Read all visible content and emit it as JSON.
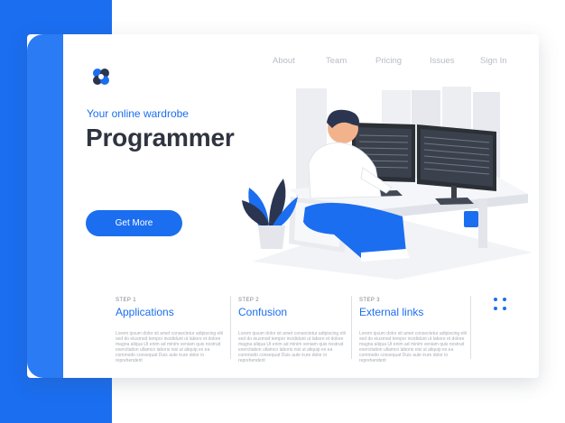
{
  "nav": {
    "items": [
      "About",
      "Team",
      "Pricing",
      "Issues",
      "Sign In"
    ]
  },
  "hero": {
    "tagline": "Your online wardrobe",
    "title": "Programmer",
    "cta": "Get More"
  },
  "steps": [
    {
      "number": "STEP 1",
      "title": "Applications",
      "body": "Lorem ipsum dolor sit amet consectetur adipiscing elit sed do eiusmod tempor incididunt ut labore et dolore magna aliqua Ut enim ad minim veniam quis nostrud exercitation ullamco laboris nisi ut aliquip ex ea commodo consequat Duis aute irure dolor in reprehenderit"
    },
    {
      "number": "STEP 2",
      "title": "Confusion",
      "body": "Lorem ipsum dolor sit amet consectetur adipiscing elit sed do eiusmod tempor incididunt ut labore et dolore magna aliqua Ut enim ad minim veniam quis nostrud exercitation ullamco laboris nisi ut aliquip ex ea commodo consequat Duis aute irure dolor in reprehenderit"
    },
    {
      "number": "STEP 3",
      "title": "External links",
      "body": "Lorem ipsum dolor sit amet consectetur adipiscing elit sed do eiusmod tempor incididunt ut labore et dolore magna aliqua Ut enim ad minim veniam quis nostrud exercitation ullamco laboris nisi ut aliquip ex ea commodo consequat Duis aute irure dolor in reprehenderit"
    }
  ],
  "icons": {
    "logo": "hexagon-logo-icon",
    "menu": "grid-dots-icon"
  },
  "colors": {
    "accent": "#1b6ef0",
    "title": "#2f3440",
    "nav": "#b7bcc6",
    "screen": "#2b2f36"
  }
}
